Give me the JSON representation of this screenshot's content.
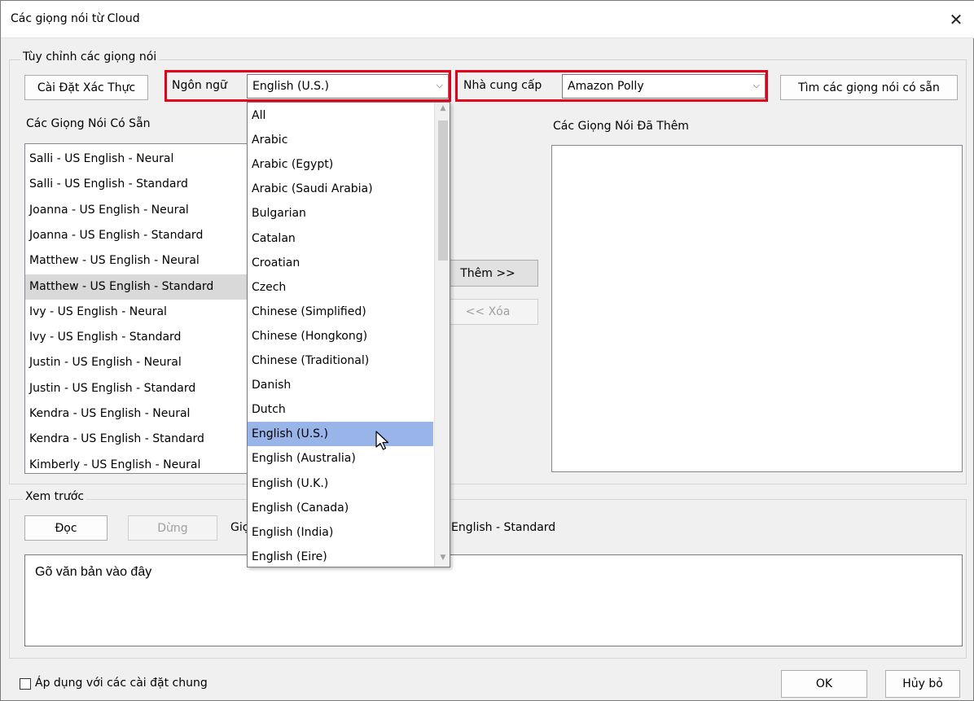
{
  "window": {
    "title": "Các giọng nói từ Cloud",
    "close_symbol": "✕"
  },
  "customize": {
    "legend": "Tùy chỉnh các giọng nói",
    "auth_button": "Cài Đặt Xác Thực",
    "language_label": "Ngôn ngữ",
    "language_value": "English (U.S.)",
    "provider_label": "Nhà cung cấp",
    "provider_value": "Amazon Polly",
    "find_button": "Tìm các giọng nói có sẵn",
    "available_label": "Các Giọng Nói Có Sẵn",
    "added_label": "Các Giọng Nói Đã Thêm",
    "add_button": "Thêm >>",
    "remove_button": "<< Xóa",
    "available_voices": [
      "Salli - US English - Neural",
      "Salli - US English - Standard",
      "Joanna - US English - Neural",
      "Joanna - US English - Standard",
      "Matthew - US English - Neural",
      "Matthew - US English - Standard",
      "Ivy - US English - Neural",
      "Ivy - US English - Standard",
      "Justin - US English - Neural",
      "Justin - US English - Standard",
      "Kendra - US English - Neural",
      "Kendra - US English - Standard",
      "Kimberly - US English - Neural"
    ],
    "selected_voice_index": 5
  },
  "language_dropdown": {
    "options": [
      "All",
      "Arabic",
      "Arabic (Egypt)",
      "Arabic (Saudi Arabia)",
      "Bulgarian",
      "Catalan",
      "Croatian",
      "Czech",
      "Chinese (Simplified)",
      "Chinese (Hongkong)",
      "Chinese (Traditional)",
      "Danish",
      "Dutch",
      "English (U.S.)",
      "English (Australia)",
      "English (U.K.)",
      "English (Canada)",
      "English (India)",
      "English (Eire)"
    ],
    "highlighted_index": 13
  },
  "preview": {
    "legend": "Xem trước",
    "read_button": "Đọc",
    "stop_button": "Dừng",
    "voice_prefix": "Giọ",
    "voice_suffix": "English - Standard",
    "text_value": "Gõ văn bản vào đây"
  },
  "footer": {
    "apply_label": "Áp dụng với các cài đặt chung",
    "ok_button": "OK",
    "cancel_button": "Hủy bỏ"
  },
  "colors": {
    "highlight_red": "#e6001a",
    "dropdown_selection": "#99b4e8",
    "list_selection": "#d9d9d9"
  }
}
